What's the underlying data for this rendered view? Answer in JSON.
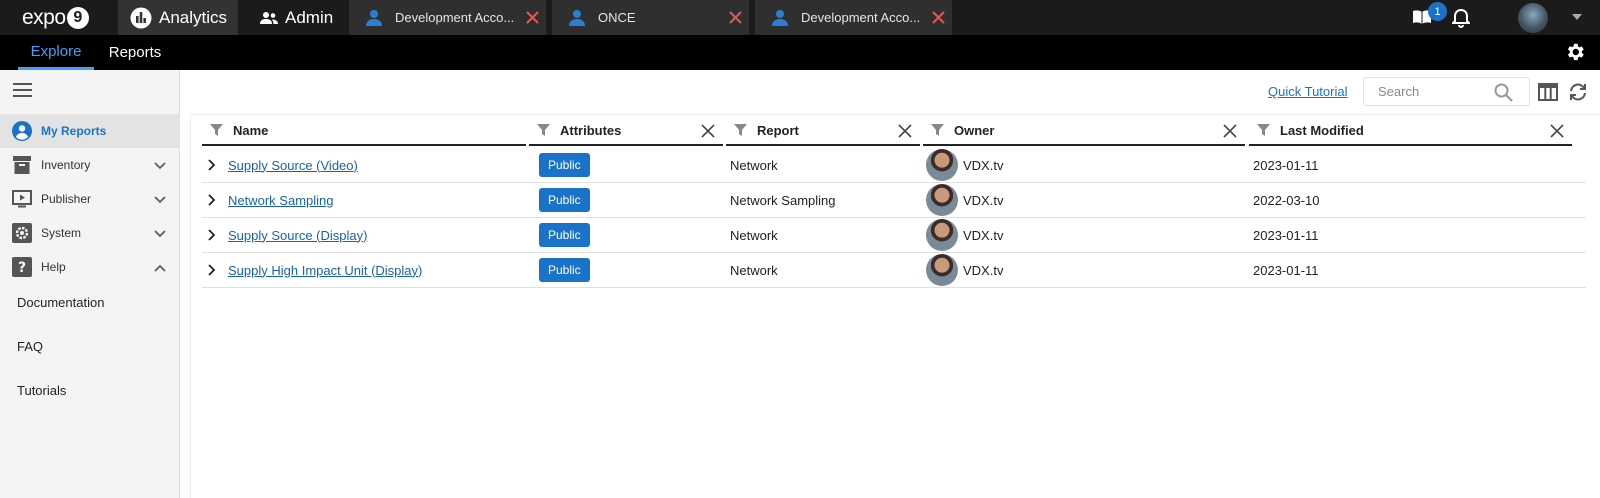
{
  "brand": {
    "logo_text": "expo",
    "logo_number": "9"
  },
  "app_tabs": [
    {
      "label": "Analytics",
      "icon": "bar-chart-icon"
    },
    {
      "label": "Admin",
      "icon": "users-icon"
    }
  ],
  "window_tabs": [
    {
      "label": "Development Acco...",
      "icon": "person-icon"
    },
    {
      "label": "ONCE",
      "icon": "person-icon"
    },
    {
      "label": "Development Acco...",
      "icon": "person-icon"
    }
  ],
  "top_right": {
    "notification_count": "1",
    "colors": {
      "badge": "#1a73c8",
      "close_x": "#e05a5a"
    }
  },
  "nav": {
    "explore": "Explore",
    "reports": "Reports",
    "active": "Explore"
  },
  "sidebar": {
    "items": [
      {
        "label": "My Reports",
        "icon": "user-circle-icon",
        "active": true
      },
      {
        "label": "Inventory",
        "icon": "archive-icon",
        "expanded": false
      },
      {
        "label": "Publisher",
        "icon": "monitor-play-icon",
        "expanded": false
      },
      {
        "label": "System",
        "icon": "gear-icon",
        "expanded": false
      },
      {
        "label": "Help",
        "icon": "question-icon",
        "expanded": true
      }
    ],
    "help_links": [
      "Documentation",
      "FAQ",
      "Tutorials"
    ]
  },
  "toolbar": {
    "quick_tutorial": "Quick Tutorial",
    "search_placeholder": "Search"
  },
  "table": {
    "columns": [
      "Name",
      "Attributes",
      "Report",
      "Owner",
      "Last Modified"
    ],
    "rows": [
      {
        "name": "Supply Source (Video)",
        "attribute": "Public",
        "report": "Network",
        "owner": "VDX.tv",
        "modified": "2023-01-11"
      },
      {
        "name": "Network Sampling",
        "attribute": "Public",
        "report": "Network Sampling",
        "owner": "VDX.tv",
        "modified": "2022-03-10"
      },
      {
        "name": "Supply Source (Display)",
        "attribute": "Public",
        "report": "Network",
        "owner": "VDX.tv",
        "modified": "2023-01-11"
      },
      {
        "name": "Supply High Impact Unit (Display)",
        "attribute": "Public",
        "report": "Network",
        "owner": "VDX.tv",
        "modified": "2023-01-11"
      }
    ]
  }
}
